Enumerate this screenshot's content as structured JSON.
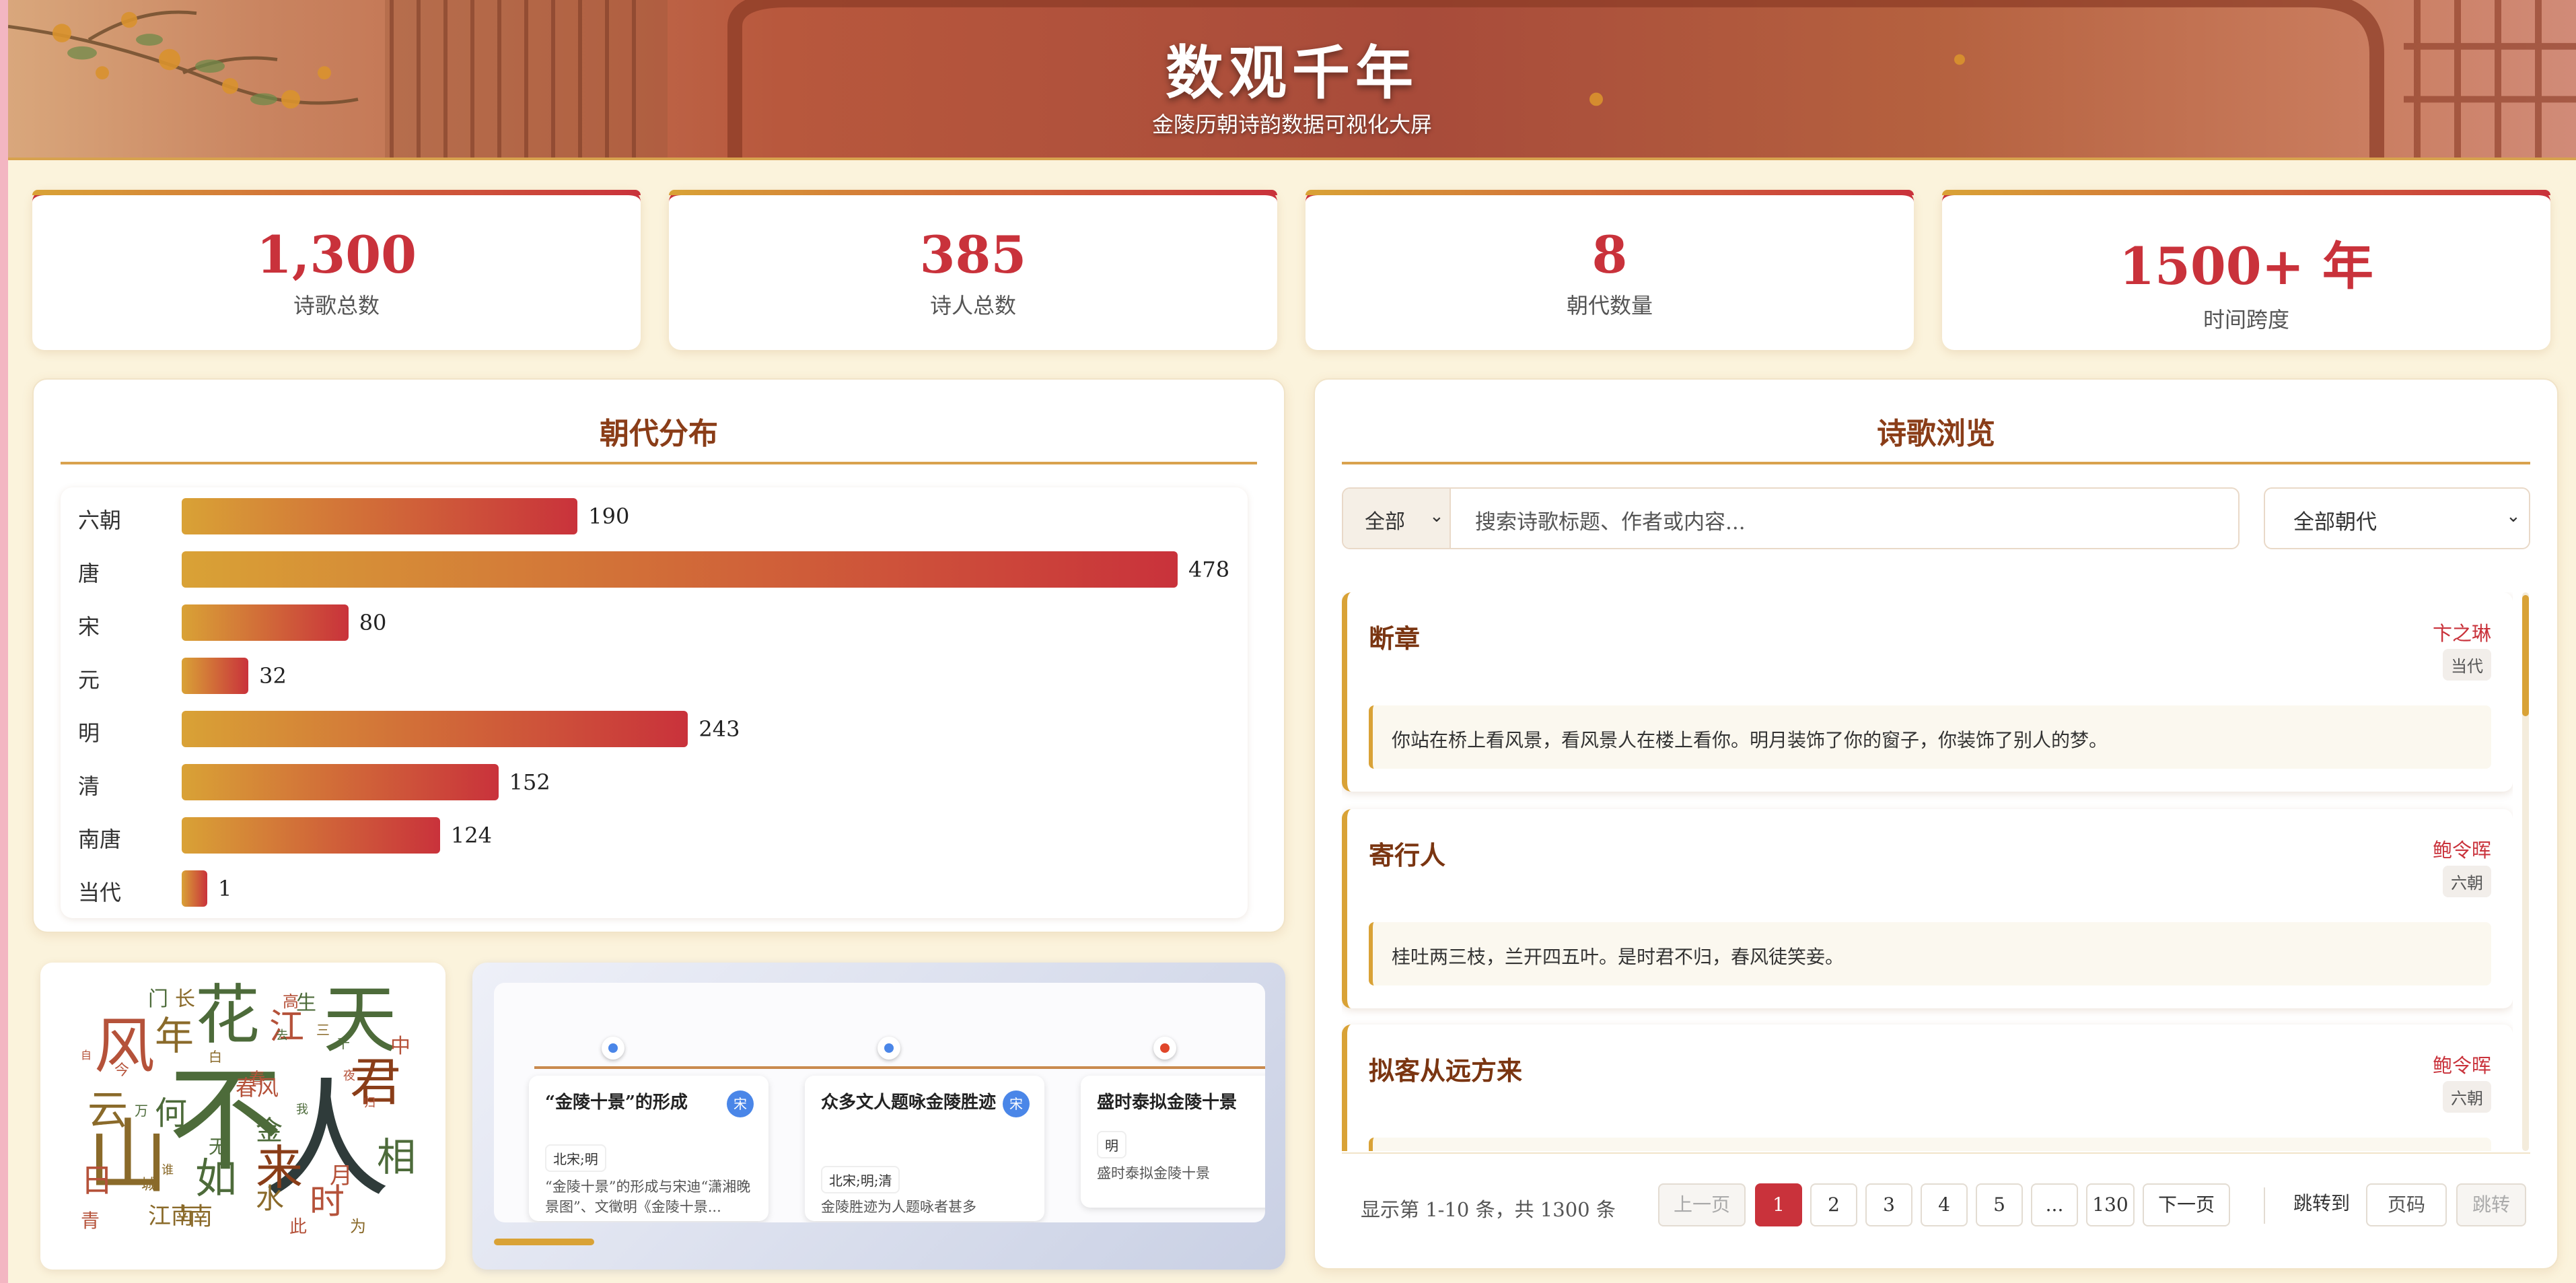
{
  "header": {
    "title": "数观千年",
    "subtitle": "金陵历朝诗韵数据可视化大屏"
  },
  "stats": [
    {
      "value": "1,300",
      "label": "诗歌总数"
    },
    {
      "value": "385",
      "label": "诗人总数"
    },
    {
      "value": "8",
      "label": "朝代数量"
    },
    {
      "value": "1500+ 年",
      "label": "时间跨度"
    }
  ],
  "dynasty_panel": {
    "title": "朝代分布"
  },
  "chart_data": {
    "type": "bar",
    "orientation": "horizontal",
    "categories": [
      "六朝",
      "唐",
      "宋",
      "元",
      "明",
      "清",
      "南唐",
      "当代"
    ],
    "values": [
      190,
      478,
      80,
      32,
      243,
      152,
      124,
      1
    ],
    "xlim": [
      0,
      478
    ],
    "colors": {
      "bar_start": "#d9a236",
      "bar_end": "#c9323b"
    }
  },
  "wordcloud": {
    "words": [
      {
        "text": "不",
        "color": "#4d6b3a"
      },
      {
        "text": "人",
        "color": "#2f3b3a"
      },
      {
        "text": "山",
        "color": "#8a6a2a"
      },
      {
        "text": "天",
        "color": "#4d6b3a"
      },
      {
        "text": "花",
        "color": "#4d6b3a"
      },
      {
        "text": "风",
        "color": "#b5523a"
      },
      {
        "text": "君",
        "color": "#8a3d18"
      },
      {
        "text": "来",
        "color": "#8a3d18"
      },
      {
        "text": "如",
        "color": "#4d6b3a"
      },
      {
        "text": "云",
        "color": "#8a6a2a"
      },
      {
        "text": "年",
        "color": "#8a6a2a"
      },
      {
        "text": "江",
        "color": "#b5523a"
      },
      {
        "text": "相",
        "color": "#4d6b3a"
      },
      {
        "text": "时",
        "color": "#b5523a"
      },
      {
        "text": "何",
        "color": "#4d6b3a"
      },
      {
        "text": "日",
        "color": "#b5523a"
      },
      {
        "text": "水",
        "color": "#8a6a2a"
      },
      {
        "text": "金",
        "color": "#4d6b3a"
      },
      {
        "text": "南",
        "color": "#8a6a2a"
      },
      {
        "text": "月",
        "color": "#b5523a"
      },
      {
        "text": "江南",
        "color": "#8a6a2a"
      },
      {
        "text": "春风",
        "color": "#b5523a"
      },
      {
        "text": "门",
        "color": "#4d6b3a"
      },
      {
        "text": "长",
        "color": "#8a6a2a"
      },
      {
        "text": "高",
        "color": "#b5523a"
      },
      {
        "text": "生",
        "color": "#4d6b3a"
      },
      {
        "text": "中",
        "color": "#b5523a"
      },
      {
        "text": "无",
        "color": "#4d6b3a"
      },
      {
        "text": "此",
        "color": "#b5523a"
      },
      {
        "text": "为",
        "color": "#8a6a2a"
      },
      {
        "text": "上",
        "color": "#8a6a2a"
      },
      {
        "text": "青",
        "color": "#b5523a"
      },
      {
        "text": "城",
        "color": "#8a6a2a"
      },
      {
        "text": "今",
        "color": "#b5523a"
      },
      {
        "text": "万",
        "color": "#4d6b3a"
      },
      {
        "text": "白",
        "color": "#8a6a2a"
      },
      {
        "text": "春",
        "color": "#b5523a"
      },
      {
        "text": "我",
        "color": "#4d6b3a"
      },
      {
        "text": "夜",
        "color": "#b5523a"
      },
      {
        "text": "三",
        "color": "#8a6a2a"
      },
      {
        "text": "千",
        "color": "#4d6b3a"
      },
      {
        "text": "自",
        "color": "#b5523a"
      },
      {
        "text": "谁",
        "color": "#8a6a2a"
      },
      {
        "text": "去",
        "color": "#4d6b3a"
      },
      {
        "text": "归",
        "color": "#b5523a"
      }
    ]
  },
  "timeline": {
    "events": [
      {
        "title": "“金陵十景”的形成",
        "badge": "宋",
        "dynasties": "北宋;明",
        "desc": "“金陵十景”的形成与宋迪“潇湘晚景图”、文徵明《金陵十景...",
        "dot_color": "#4a86e8"
      },
      {
        "title": "众多文人题咏金陵胜迹",
        "badge": "宋",
        "dynasties": "北宋;明;清",
        "desc": "金陵胜迹为人题咏者甚多",
        "dot_color": "#4a86e8"
      },
      {
        "title": "盛时泰拟金陵十景",
        "badge": "",
        "dynasties": "明",
        "desc": "盛时泰拟金陵十景",
        "dot_color": "#e0462a"
      }
    ],
    "progress": 0.13
  },
  "poem_panel": {
    "title": "诗歌浏览",
    "filter_select": "全部",
    "search_placeholder": "搜索诗歌标题、作者或内容...",
    "dynasty_select": "全部朝代"
  },
  "poems": [
    {
      "title": "断章",
      "author": "卞之琳",
      "dynasty": "当代",
      "content": "你站在桥上看风景，看风景人在楼上看你。明月装饰了你的窗子，你装饰了别人的梦。"
    },
    {
      "title": "寄行人",
      "author": "鲍令晖",
      "dynasty": "六朝",
      "content": "桂吐两三枝，兰开四五叶。是时君不归，春风徒笑妾。"
    },
    {
      "title": "拟客从远方来",
      "author": "鲍令晖",
      "dynasty": "六朝",
      "content": ""
    }
  ],
  "pagination": {
    "info": "显示第 1-10 条，共 1300 条",
    "prev": "上一页",
    "pages": [
      "1",
      "2",
      "3",
      "4",
      "5",
      "...",
      "130"
    ],
    "next": "下一页",
    "jump_label": "跳转到",
    "page_placeholder": "页码",
    "jump_button": "跳转"
  }
}
